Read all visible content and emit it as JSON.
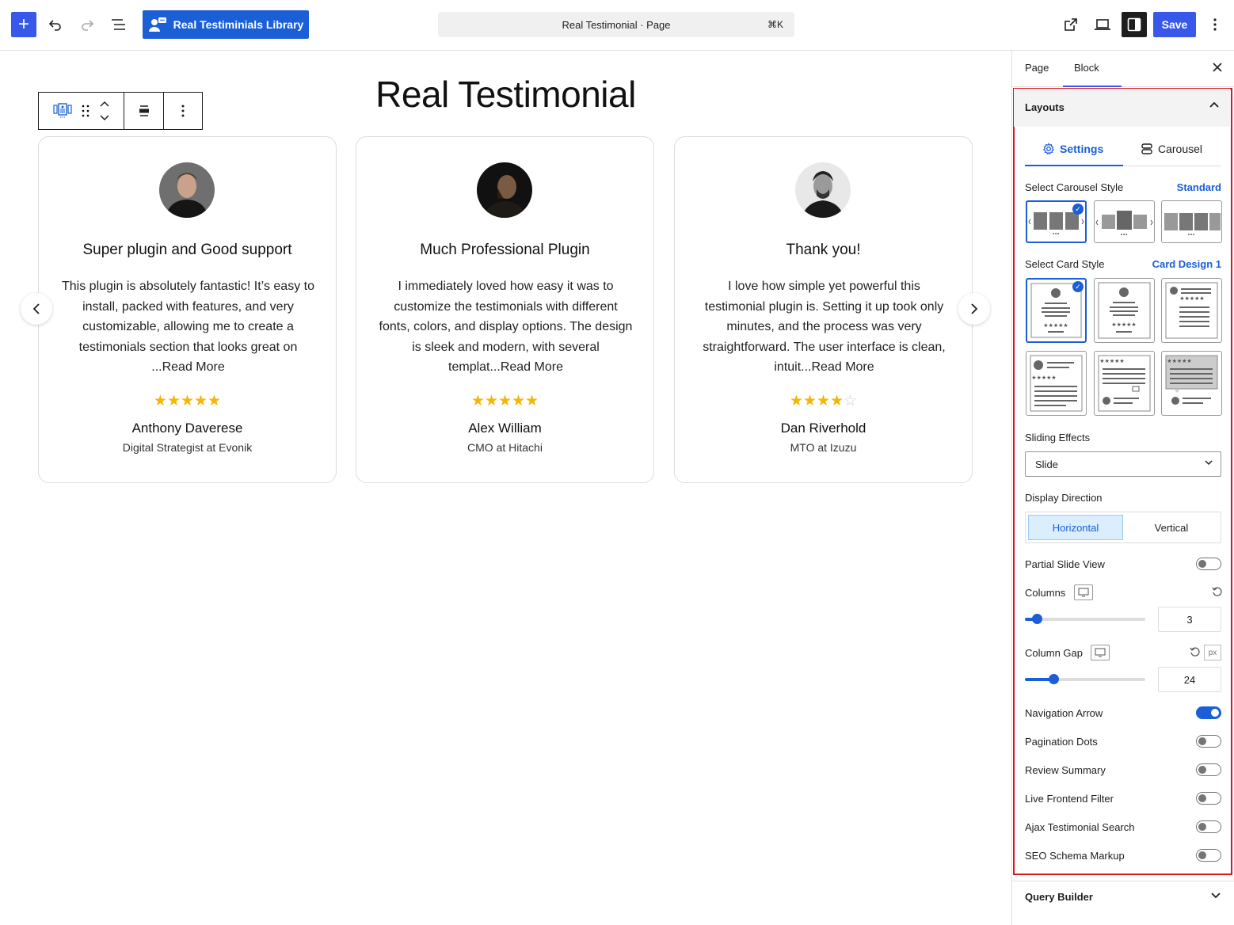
{
  "topbar": {
    "add_icon": "plus-icon",
    "library_label": "Real Testiminials Library",
    "command_title": "Real Testimonial · Page",
    "command_shortcut": "⌘K",
    "save_label": "Save",
    "accent": "#3858e9"
  },
  "page": {
    "title": "Real Testimonial"
  },
  "cards": [
    {
      "title": "Super plugin and Good support",
      "body": "This plugin is absolutely fantastic! It’s easy to install, packed with features, and very customizable, allowing me to create a testimonials section that looks great on ...Read More",
      "rating": 5,
      "stars": "★★★★★",
      "name": "Anthony Daverese",
      "role": "Digital Strategist at Evonik"
    },
    {
      "title": "Much Professional Plugin",
      "body": "I immediately loved how easy it was to customize the testimonials with different fonts, colors, and display options. The design is sleek and modern, with several templat...Read More",
      "rating": 5,
      "stars": "★★★★★",
      "name": "Alex William",
      "role": "CMO at Hitachi"
    },
    {
      "title": "Thank you!",
      "body": "I love how simple yet powerful this testimonial plugin is. Setting it up took only minutes, and the process was very straightforward. The user interface is clean, intuit...Read More",
      "rating": 4,
      "stars": "★★★★",
      "stars_off": "☆",
      "name": "Dan Riverhold",
      "role": "MTO at Izuzu"
    }
  ],
  "sidebar": {
    "tabs": [
      "Page",
      "Block"
    ],
    "layouts_label": "Layouts",
    "subtabs": [
      "Settings",
      "Carousel"
    ],
    "carousel_style_label": "Select Carousel Style",
    "carousel_style_value": "Standard",
    "card_style_label": "Select Card Style",
    "card_style_value": "Card Design 1",
    "sliding_effects_label": "Sliding Effects",
    "sliding_effects_value": "Slide",
    "display_direction_label": "Display Direction",
    "direction_options": [
      "Horizontal",
      "Vertical"
    ],
    "partial_slide_label": "Partial Slide View",
    "columns_label": "Columns",
    "columns_value": "3",
    "columns_fraction": 0.1,
    "column_gap_label": "Column Gap",
    "column_gap_value": "24",
    "column_gap_fraction": 0.24,
    "unit_label": "px",
    "toggles": [
      {
        "label": "Navigation Arrow",
        "on": true
      },
      {
        "label": "Pagination Dots",
        "on": false
      },
      {
        "label": "Review Summary",
        "on": false
      },
      {
        "label": "Live Frontend Filter",
        "on": false
      },
      {
        "label": "Ajax Testimonial Search",
        "on": false
      },
      {
        "label": "SEO Schema Markup",
        "on": false
      }
    ],
    "query_builder_label": "Query Builder"
  }
}
